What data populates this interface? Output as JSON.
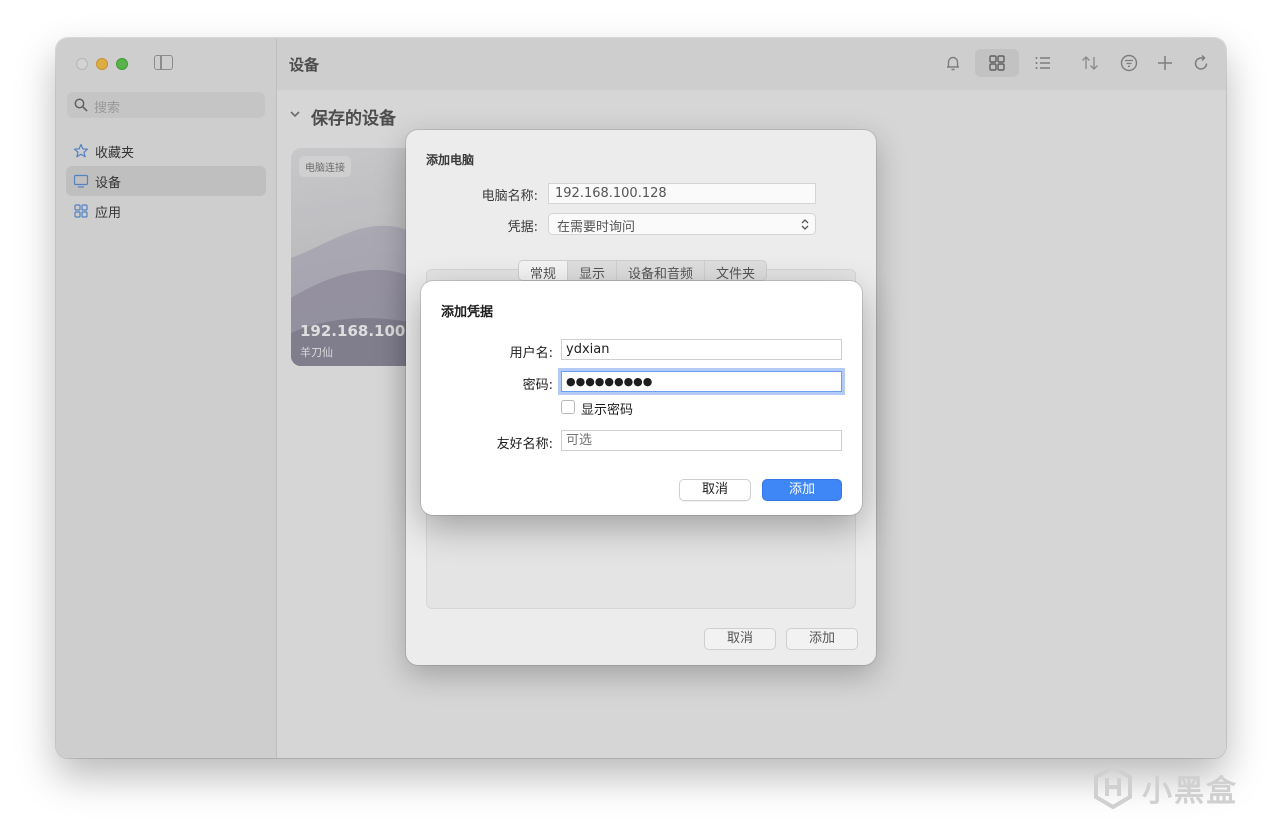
{
  "sidebar": {
    "search_placeholder": "搜索",
    "items": [
      {
        "label": "收藏夹",
        "icon": "star-icon"
      },
      {
        "label": "设备",
        "icon": "display-icon",
        "selected": true
      },
      {
        "label": "应用",
        "icon": "apps-icon"
      }
    ]
  },
  "toolbar": {
    "title": "设备",
    "icons": [
      "bell-icon",
      "grid-view-icon",
      "list-view-icon",
      "sort-icon",
      "filter-icon",
      "add-icon",
      "refresh-icon"
    ]
  },
  "main": {
    "section_title": "保存的设备",
    "card": {
      "badge": "电脑连接",
      "ip": "192.168.100.11",
      "subtitle": "羊刀仙"
    }
  },
  "add_pc_sheet": {
    "title": "添加电脑",
    "pc_name_label": "电脑名称:",
    "pc_name_value": "192.168.100.128",
    "credentials_label": "凭据:",
    "credentials_value": "在需要时询问",
    "tabs": [
      "常规",
      "显示",
      "设备和音频",
      "文件夹"
    ],
    "active_tab": "常规",
    "cancel_label": "取消",
    "add_label": "添加"
  },
  "credentials_dialog": {
    "title": "添加凭据",
    "username_label": "用户名:",
    "username_value": "ydxian",
    "password_label": "密码:",
    "password_value": "●●●●●●●●●",
    "show_password_label": "显示密码",
    "show_password_checked": false,
    "friendly_name_label": "友好名称:",
    "friendly_name_placeholder": "可选",
    "cancel_label": "取消",
    "add_label": "添加"
  },
  "watermark": {
    "text": "小黑盒"
  },
  "colors": {
    "accent": "#3f86f6",
    "traffic_close": "#e8e8e8",
    "traffic_minimize": "#f4be4f",
    "traffic_maximize": "#61c554"
  }
}
